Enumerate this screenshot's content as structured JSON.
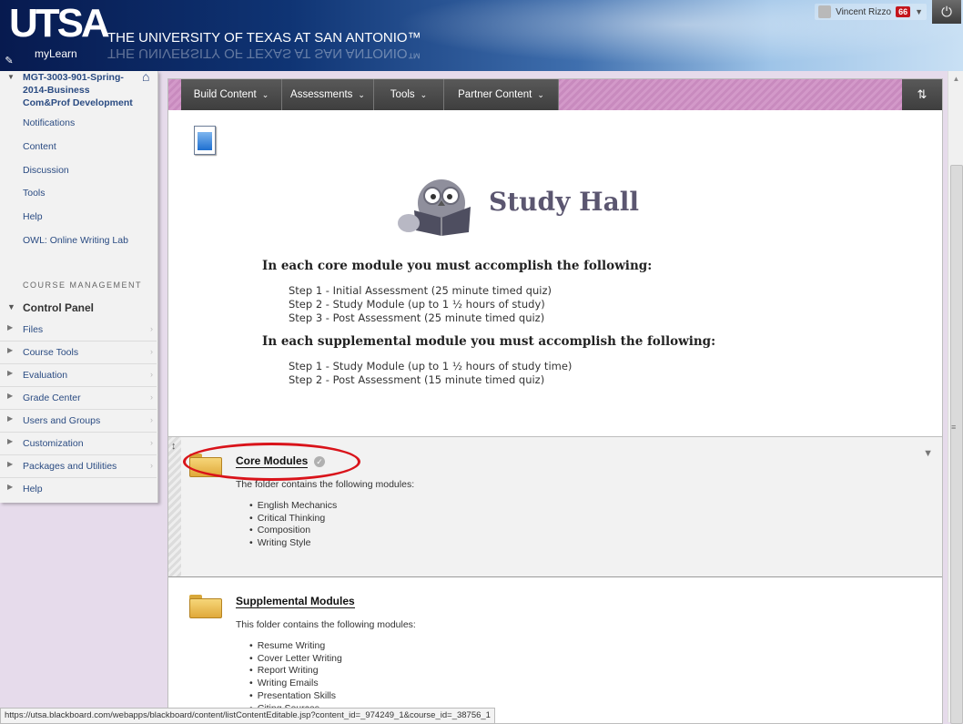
{
  "header": {
    "logo": "UTSA",
    "university": "THE UNIVERSITY OF TEXAS AT SAN ANTONIO™",
    "portal": "myLearn",
    "user_name": "Vincent Rizzo",
    "notification_count": "66"
  },
  "sidebar": {
    "course_title": "MGT-3003-901-Spring-2014-Business Com&Prof Development",
    "menu": [
      "Notifications",
      "Content",
      "Discussion",
      "Tools",
      "Help",
      "OWL: Online Writing Lab"
    ],
    "course_management_label": "COURSE MANAGEMENT",
    "control_panel_label": "Control Panel",
    "control_panel_items": [
      "Files",
      "Course Tools",
      "Evaluation",
      "Grade Center",
      "Users and Groups",
      "Customization",
      "Packages and Utilities",
      "Help"
    ]
  },
  "toolbar": {
    "build_content": "Build Content",
    "assessments": "Assessments",
    "tools": "Tools",
    "partner_content": "Partner Content"
  },
  "study_hall": {
    "title": "Study Hall",
    "core_heading": "In each core module you must accomplish the following:",
    "core_steps": [
      "Step 1 - Initial Assessment (25 minute timed quiz)",
      "Step 2 - Study Module (up to 1 ½ hours of study)",
      "Step 3 - Post Assessment (25 minute timed quiz)"
    ],
    "supp_heading": "In each supplemental module you must accomplish the following:",
    "supp_steps": [
      "Step 1 - Study Module (up to 1 ½ hours of study time)",
      "Step 2 - Post Assessment (15 minute timed quiz)"
    ]
  },
  "core_modules": {
    "title": "Core Modules",
    "description": "The folder contains the following modules:",
    "items": [
      "English Mechanics",
      "Critical Thinking",
      "Composition",
      "Writing Style"
    ]
  },
  "supplemental_modules": {
    "title": "Supplemental Modules",
    "description": "This folder contains the following modules:",
    "items": [
      "Resume Writing",
      "Cover Letter Writing",
      "Report Writing",
      "Writing Emails",
      "Presentation Skills",
      "Citing Sources"
    ]
  },
  "status_bar": {
    "url": "https://utsa.blackboard.com/webapps/blackboard/content/listContentEditable.jsp?content_id=_974249_1&course_id=_38756_1"
  },
  "colors": {
    "header_dark": "#0f3474",
    "toolbar_pink": "#d399c9",
    "sidebar_link": "#2a4b82",
    "highlight_red": "#d9131a"
  }
}
